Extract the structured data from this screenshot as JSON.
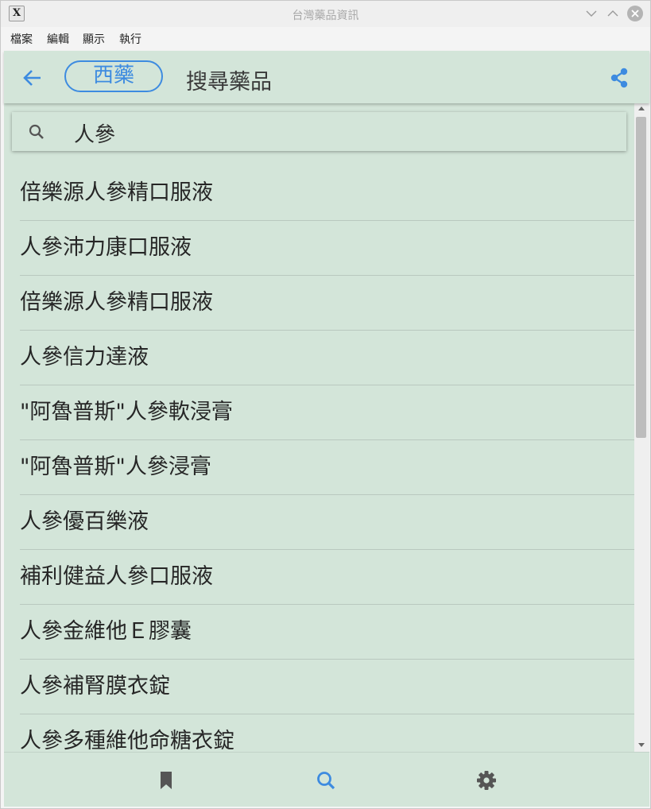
{
  "window": {
    "title": "台灣藥品資訊",
    "app_icon": "X"
  },
  "menubar": {
    "items": [
      "檔案",
      "編輯",
      "顯示",
      "執行"
    ]
  },
  "header": {
    "back_icon": "arrow-left-icon",
    "category_chip": "西藥",
    "title": "搜尋藥品",
    "share_icon": "share-icon",
    "accent_color": "#3d8be0",
    "background_color": "#d3e5d9"
  },
  "search": {
    "icon": "search-icon",
    "value": "人參"
  },
  "results": [
    "倍樂源人參精口服液",
    "人參沛力康口服液",
    "倍樂源人參精口服液",
    "人參信力達液",
    "\"阿魯普斯\"人參軟浸膏",
    "\"阿魯普斯\"人參浸膏",
    "人參優百樂液",
    "補利健益人參口服液",
    "人參金維他Ｅ膠囊",
    "人參補腎膜衣錠",
    "人參多種維他命糖衣錠"
  ],
  "bottom_nav": {
    "items": [
      "bookmark-icon",
      "search-icon",
      "settings-icon"
    ],
    "active": "search-icon"
  }
}
